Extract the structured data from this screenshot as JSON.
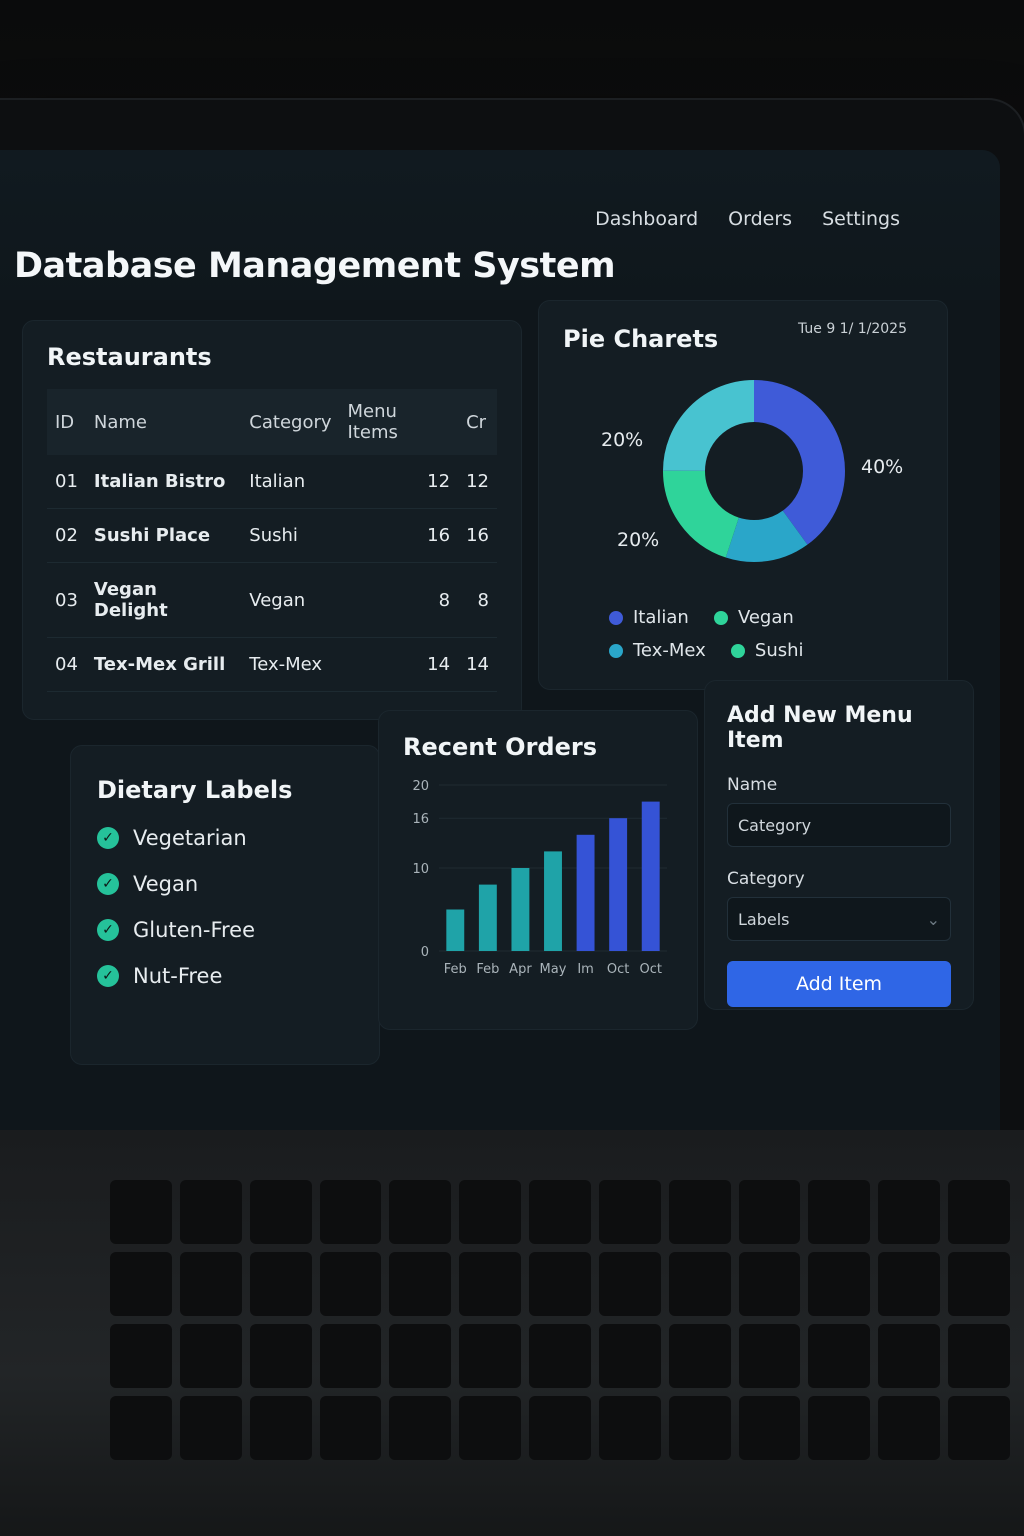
{
  "app": {
    "title": "Database Management System",
    "nav": [
      "Dashboard",
      "Orders",
      "Settings"
    ]
  },
  "restaurants": {
    "title": "Restaurants",
    "columns": [
      "ID",
      "Name",
      "Category",
      "Menu Items",
      "Cr"
    ],
    "rows": [
      {
        "id": "01",
        "name": "Italian Bistro",
        "category": "Italian",
        "menu_items": "12",
        "cr": "12"
      },
      {
        "id": "02",
        "name": "Sushi Place",
        "category": "Sushi",
        "menu_items": "16",
        "cr": "16"
      },
      {
        "id": "03",
        "name": "Vegan Delight",
        "category": "Vegan",
        "menu_items": "8",
        "cr": "8"
      },
      {
        "id": "04",
        "name": "Tex-Mex Grill",
        "category": "Tex-Mex",
        "menu_items": "14",
        "cr": "14"
      }
    ]
  },
  "pie": {
    "title": "Pie Charets",
    "date": "Tue 9 1/ 1/2025",
    "labels": [
      "20%",
      "40%",
      "20%"
    ],
    "legend": [
      {
        "name": "Italian",
        "color": "#3f5bd8"
      },
      {
        "name": "Vegan",
        "color": "#2fd49a"
      },
      {
        "name": "Tex-Mex",
        "color": "#2aa6c9"
      },
      {
        "name": "Sushi",
        "color": "#2fd49a"
      }
    ]
  },
  "dietary": {
    "title": "Dietary Labels",
    "items": [
      "Vegetarian",
      "Vegan",
      "Gluten-Free",
      "Nut-Free"
    ]
  },
  "chart_data": {
    "type": "bar",
    "title": "Recent Orders",
    "categories": [
      "Feb",
      "Feb",
      "Apr",
      "May",
      "Im",
      "Oct",
      "Oct"
    ],
    "values": [
      5,
      8,
      10,
      12,
      14,
      16,
      18
    ],
    "yticks": [
      "20",
      "16",
      "10",
      "0"
    ],
    "ylim": [
      0,
      20
    ],
    "colors": [
      "#1fa3a8",
      "#1fa3a8",
      "#1fa3a8",
      "#1fa3a8",
      "#3553d6",
      "#3553d6",
      "#3553d6"
    ]
  },
  "add_item": {
    "title": "Add New Menu Item",
    "name_label": "Name",
    "name_value": "Category",
    "category_label": "Category",
    "category_value": "Labels",
    "button": "Add Item"
  }
}
